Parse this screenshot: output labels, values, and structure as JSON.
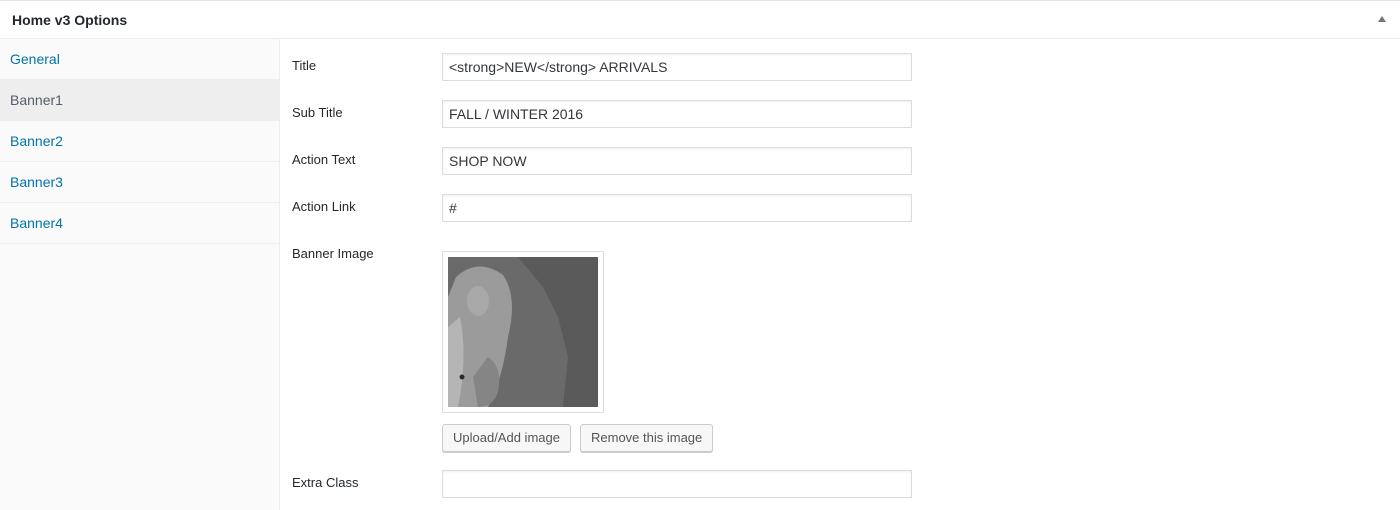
{
  "metabox": {
    "title": "Home v3 Options"
  },
  "sidebar": {
    "tabs": [
      {
        "label": "General"
      },
      {
        "label": "Banner1"
      },
      {
        "label": "Banner2"
      },
      {
        "label": "Banner3"
      },
      {
        "label": "Banner4"
      }
    ],
    "active_tab": "Banner1"
  },
  "form": {
    "title": {
      "label": "Title",
      "value": "<strong>NEW</strong> ARRIVALS"
    },
    "sub_title": {
      "label": "Sub Title",
      "value": "FALL / WINTER 2016"
    },
    "action_text": {
      "label": "Action Text",
      "value": "SHOP NOW"
    },
    "action_link": {
      "label": "Action Link",
      "value": "#"
    },
    "banner_image": {
      "label": "Banner Image",
      "upload_label": "Upload/Add image",
      "remove_label": "Remove this image"
    },
    "extra_class": {
      "label": "Extra Class",
      "value": ""
    }
  },
  "colors": {
    "link": "#0073aa",
    "active_tab_bg": "#eeeeee"
  }
}
